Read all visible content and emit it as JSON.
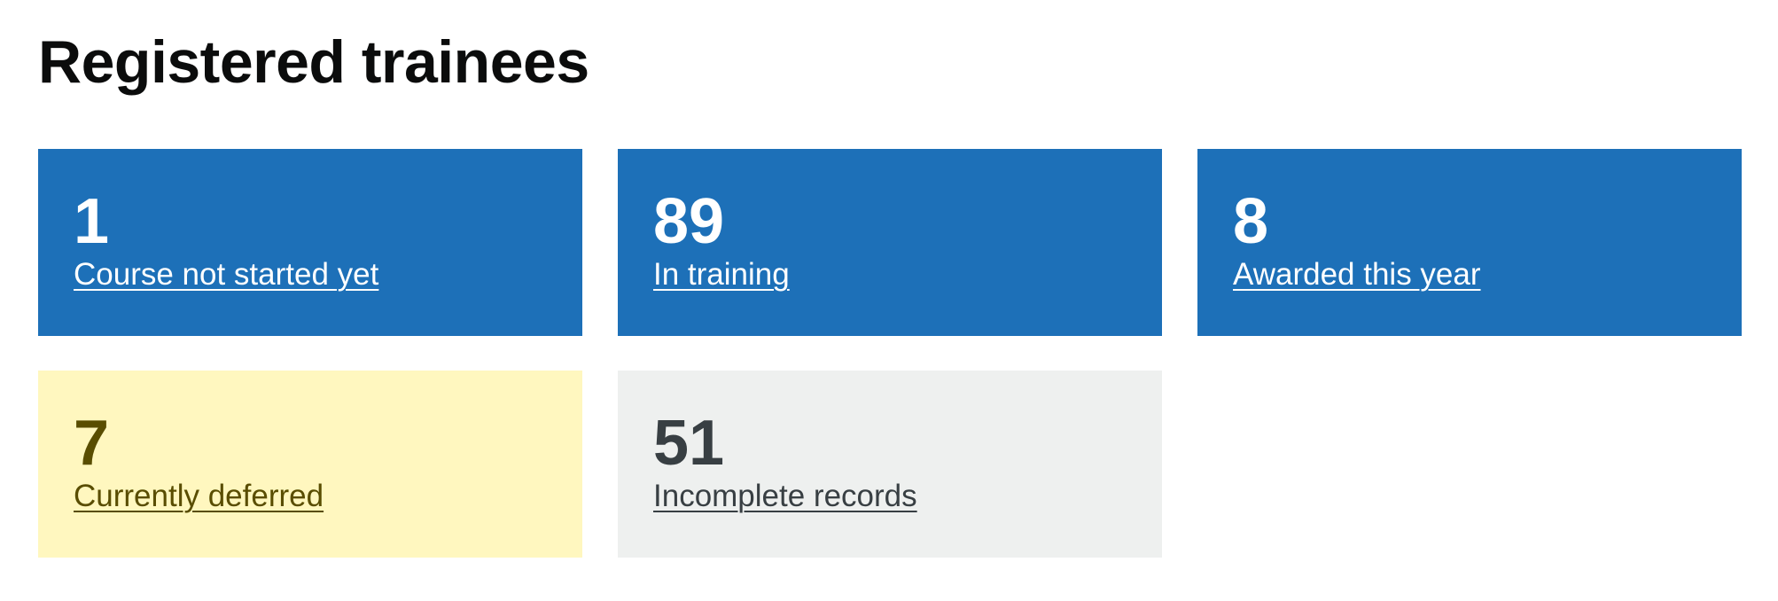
{
  "page": {
    "title": "Registered trainees"
  },
  "cards": [
    {
      "number": "1",
      "label": "Course not started yet",
      "style": "blue",
      "background": "#1d70b8",
      "text_color": "#ffffff"
    },
    {
      "number": "89",
      "label": "In training",
      "style": "blue",
      "background": "#1d70b8",
      "text_color": "#ffffff"
    },
    {
      "number": "8",
      "label": "Awarded this year",
      "style": "blue",
      "background": "#1d70b8",
      "text_color": "#ffffff"
    },
    {
      "number": "7",
      "label": "Currently deferred",
      "style": "yellow",
      "background": "#fff7bf",
      "text_color": "#594d00"
    },
    {
      "number": "51",
      "label": "Incomplete records",
      "style": "grey",
      "background": "#eef0ef",
      "text_color": "#383f43"
    }
  ]
}
